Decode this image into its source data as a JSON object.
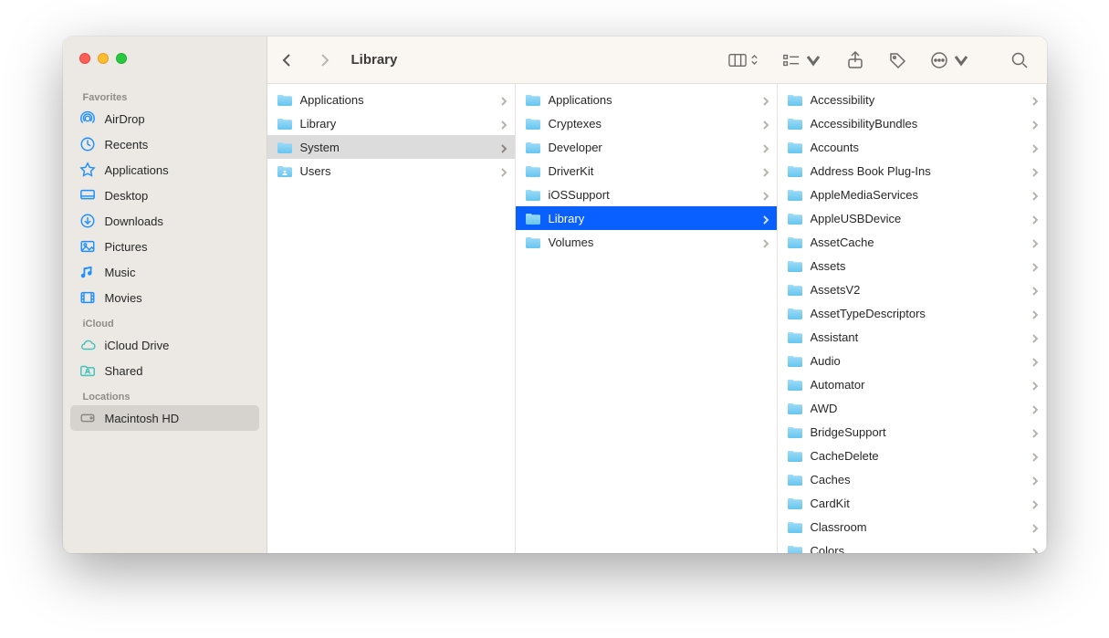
{
  "window": {
    "title": "Library"
  },
  "sidebar": {
    "sections": [
      {
        "heading": "Favorites",
        "items": [
          {
            "icon": "airdrop",
            "label": "AirDrop"
          },
          {
            "icon": "recents",
            "label": "Recents"
          },
          {
            "icon": "apps",
            "label": "Applications"
          },
          {
            "icon": "desktop",
            "label": "Desktop"
          },
          {
            "icon": "downloads",
            "label": "Downloads"
          },
          {
            "icon": "pictures",
            "label": "Pictures"
          },
          {
            "icon": "music",
            "label": "Music"
          },
          {
            "icon": "movies",
            "label": "Movies"
          }
        ]
      },
      {
        "heading": "iCloud",
        "items": [
          {
            "icon": "icloud",
            "label": "iCloud Drive"
          },
          {
            "icon": "shared",
            "label": "Shared"
          }
        ]
      },
      {
        "heading": "Locations",
        "items": [
          {
            "icon": "disk",
            "label": "Macintosh HD",
            "selected": true
          }
        ]
      }
    ]
  },
  "columns": [
    {
      "items": [
        {
          "name": "Applications"
        },
        {
          "name": "Library"
        },
        {
          "name": "System",
          "selected": "grey"
        },
        {
          "name": "Users",
          "special": "users"
        }
      ]
    },
    {
      "items": [
        {
          "name": "Applications"
        },
        {
          "name": "Cryptexes"
        },
        {
          "name": "Developer"
        },
        {
          "name": "DriverKit"
        },
        {
          "name": "iOSSupport"
        },
        {
          "name": "Library",
          "selected": "blue"
        },
        {
          "name": "Volumes"
        }
      ]
    },
    {
      "items": [
        {
          "name": "Accessibility"
        },
        {
          "name": "AccessibilityBundles"
        },
        {
          "name": "Accounts"
        },
        {
          "name": "Address Book Plug-Ins"
        },
        {
          "name": "AppleMediaServices"
        },
        {
          "name": "AppleUSBDevice"
        },
        {
          "name": "AssetCache"
        },
        {
          "name": "Assets"
        },
        {
          "name": "AssetsV2"
        },
        {
          "name": "AssetTypeDescriptors"
        },
        {
          "name": "Assistant"
        },
        {
          "name": "Audio"
        },
        {
          "name": "Automator"
        },
        {
          "name": "AWD"
        },
        {
          "name": "BridgeSupport"
        },
        {
          "name": "CacheDelete"
        },
        {
          "name": "Caches"
        },
        {
          "name": "CardKit"
        },
        {
          "name": "Classroom"
        },
        {
          "name": "Colors"
        }
      ]
    }
  ]
}
